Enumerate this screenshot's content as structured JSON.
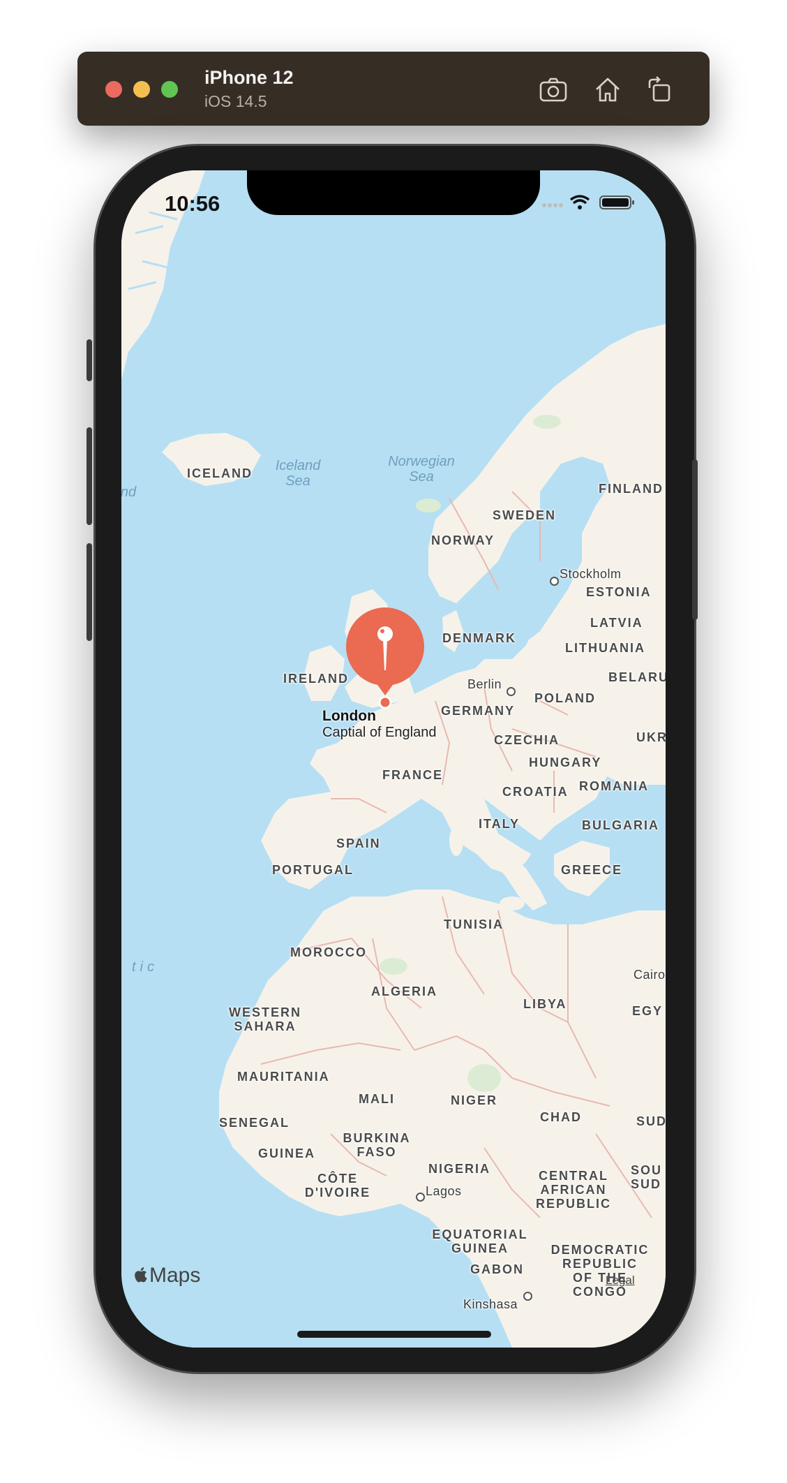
{
  "simulator": {
    "device_name": "iPhone 12",
    "os_version": "iOS 14.5",
    "toolbar_icons": [
      "screenshot-icon",
      "home-icon",
      "rotate-icon"
    ]
  },
  "status_bar": {
    "time": "10:56"
  },
  "map": {
    "countries": [
      "ICELAND",
      "NORWAY",
      "SWEDEN",
      "FINLAND",
      "ESTONIA",
      "LATVIA",
      "LITHUANIA",
      "BELARU",
      "DENMARK",
      "IRELAND",
      "GERMANY",
      "POLAND",
      "CZECHIA",
      "UKR",
      "HUNGARY",
      "ROMANIA",
      "CROATIA",
      "BULGARIA",
      "FRANCE",
      "ITALY",
      "SPAIN",
      "PORTUGAL",
      "GREECE",
      "TUNISIA",
      "MOROCCO",
      "ALGERIA",
      "LIBYA",
      "EGY",
      "WESTERN\nSAHARA",
      "MAURITANIA",
      "MALI",
      "NIGER",
      "CHAD",
      "SUD",
      "SENEGAL",
      "GUINEA",
      "BURKINA\nFASO",
      "NIGERIA",
      "CÔTE\nD'IVOIRE",
      "CENTRAL\nAFRICAN\nREPUBLIC",
      "SOU\nSUD",
      "EQUATORIAL\nGUINEA",
      "GABON",
      "DEMOCRATIC\nREPUBLIC\nOF THE\nCONGO"
    ],
    "cities": [
      "Stockholm",
      "Berlin",
      "Cairo",
      "Lagos",
      "Kinshasa"
    ],
    "seas": [
      "Iceland\nSea",
      "Norwegian\nSea",
      "tic",
      "nd"
    ],
    "pin": {
      "title": "London",
      "subtitle": "Captial of England",
      "color": "#ea6a52",
      "icon": "map-pin-icon"
    },
    "attribution": {
      "logo_text": "Maps",
      "legal": "Legal"
    }
  },
  "colors": {
    "water": "#b6dff3",
    "land": "#f6f2ea",
    "border": "#e9b8b0",
    "simulator_bar": "#362e25"
  }
}
